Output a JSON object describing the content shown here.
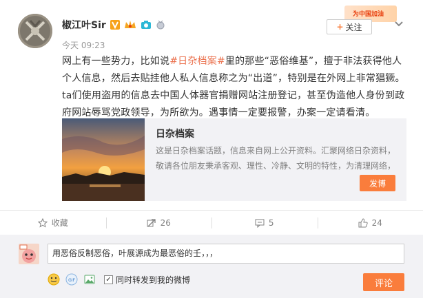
{
  "post": {
    "author": "椒江叶Sir",
    "time": "今天 09:23",
    "follow_label": "关注",
    "promo_text": "为中国加油",
    "text_before_tag": "网上有一些势力，比如说",
    "hashtag": "#日杂档案#",
    "text_after_tag": "里的那些“恶俗维基”，擅于非法获得他人个人信息，然后去贴挂他人私人信息称之为“出道”，特别是在外网上非常猖獗。ta们使用盗用的信息去中国人体器官捐赠网站注册登记，甚至伪造他人身份到政府网站辱骂党政领导，为所欲为。遇事情一定要报警，办案一定请看清。"
  },
  "share_card": {
    "title": "日杂档案",
    "description": "这是日杂档案话题，信息来自网上公开资料。汇聚网络日杂资料，敬请各位朋友秉承客观、理性、冷静、文明的特性，为清理网络，",
    "button_label": "发博"
  },
  "actions": {
    "favorite_label": "收藏",
    "repost_count": "26",
    "comment_count": "5",
    "like_count": "24"
  },
  "comment": {
    "input_value": "用恶俗反制恶俗，叶展源成为最恶俗的壬，，，",
    "repost_checkbox_label": "同时转发到我的微博",
    "repost_checked": true,
    "submit_label": "评论"
  },
  "colors": {
    "accent": "#fa7d3c",
    "hashtag": "#eb7350",
    "muted": "#808080"
  }
}
